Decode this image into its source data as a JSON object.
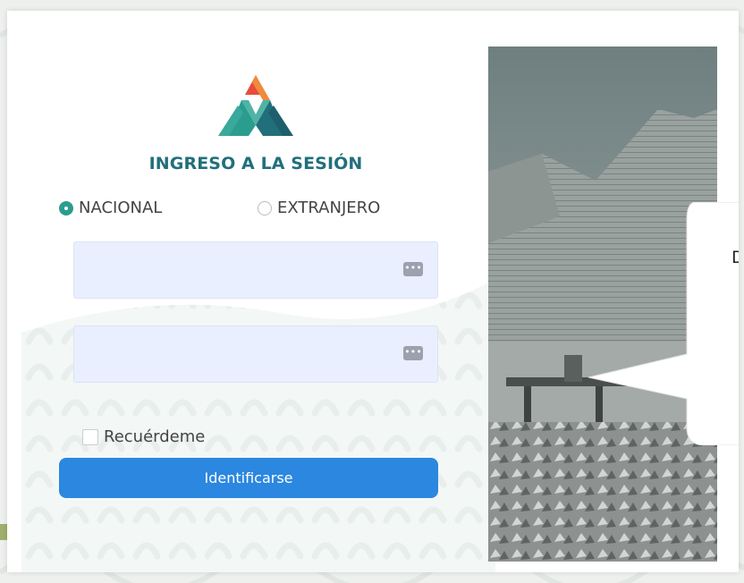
{
  "brand": {
    "title": "INGRESO A LA SESIÓN",
    "colors": {
      "teal": "#2a9d8f",
      "orange": "#f08a3c",
      "blue": "#2b87e0"
    }
  },
  "login_type": {
    "selected": "NACIONAL",
    "options": [
      {
        "id": "nacional",
        "label": "NACIONAL",
        "checked": true
      },
      {
        "id": "extranjero",
        "label": "EXTRANJERO",
        "checked": false
      }
    ]
  },
  "fields": [
    {
      "name": "username",
      "value": "",
      "placeholder": "",
      "icon": "password-manager-icon"
    },
    {
      "name": "password",
      "value": "",
      "placeholder": "",
      "icon": "password-manager-icon"
    }
  ],
  "remember": {
    "label": "Recuérdeme",
    "checked": false
  },
  "submit": {
    "label": "Identificarse"
  },
  "callout": {
    "text": "D"
  }
}
